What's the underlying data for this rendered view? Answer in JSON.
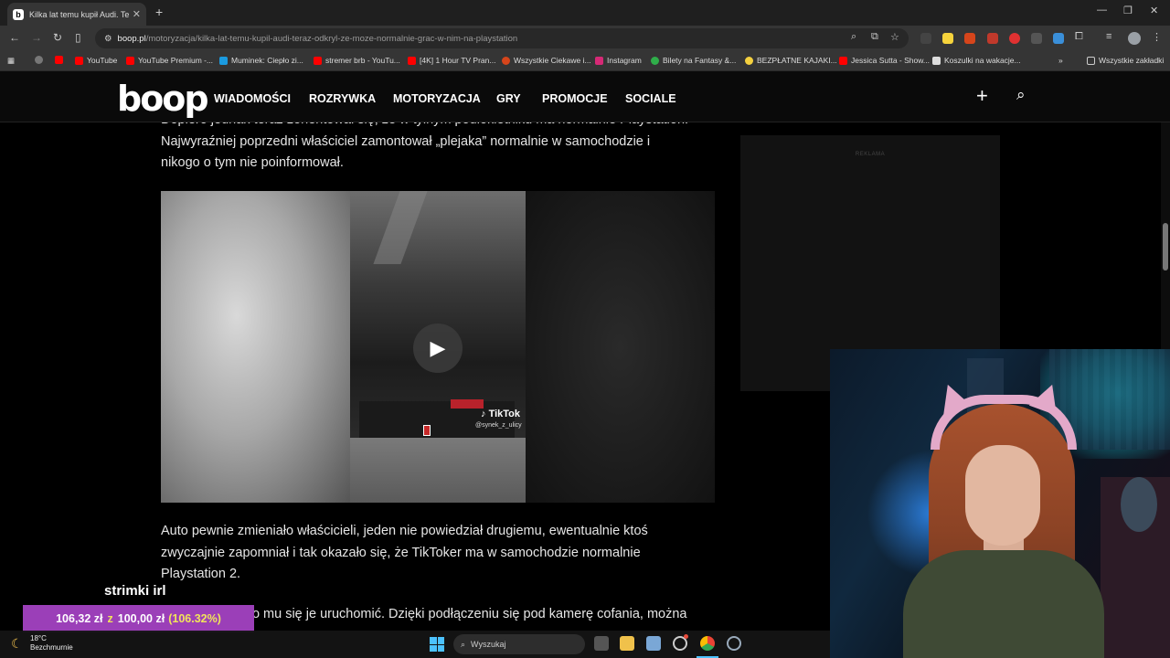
{
  "browser": {
    "tab_title": "Kilka lat temu kupił Audi. Teraz",
    "tab_favicon": "b",
    "url_host": "boop.pl",
    "url_path": "/motoryzacja/kilka-lat-temu-kupil-audi-teraz-odkryl-ze-moze-normalnie-grac-w-nim-na-playstation",
    "bookmarks": [
      {
        "label": "YouTube",
        "color": "#ff0000"
      },
      {
        "label": "YouTube Premium -...",
        "color": "#ff0000"
      },
      {
        "label": "Muminek: Ciepło zi...",
        "color": "#1b9be0"
      },
      {
        "label": "stremer brb - YouTu...",
        "color": "#ff0000"
      },
      {
        "label": "[4K] 1 Hour TV Pran...",
        "color": "#ff0000"
      },
      {
        "label": "Wszystkie Ciekawe i...",
        "color": "#d6451b"
      },
      {
        "label": "Instagram",
        "color": "#d62976"
      },
      {
        "label": "Bilety na Fantasy &...",
        "color": "#2fae4a"
      },
      {
        "label": "BEZPŁATNE KAJAKI...",
        "color": "#f4d03f"
      },
      {
        "label": "Jessica Sutta - Show...",
        "color": "#ff0000"
      },
      {
        "label": "Koszulki na wakacje...",
        "color": "#222222"
      }
    ],
    "all_bookmarks": "Wszystkie zakładki"
  },
  "site": {
    "logo": "boop",
    "nav": [
      "WIADOMOŚCI",
      "ROZRYWKA",
      "MOTORYZACJA",
      "GRY",
      "PROMOCJE",
      "SOCIALE"
    ]
  },
  "article": {
    "para1_line1": "Dopiero jednak teraz zorientował się, że w tylnym podłokietniku ma normalnie Playstation.",
    "para1_line2": "Najwyraźniej poprzedni właściciel zamontował „plejaka” normalnie w samochodzie i",
    "para1_line3": "nikogo o tym nie poinformował.",
    "para2_line1": "Auto pewnie zmieniało właścicieli, jeden nie powiedział drugiemu, ewentualnie ktoś",
    "para2_line2": "zwyczajnie zapomniał i tak okazało się, że TikToker ma w samochodzie normalnie",
    "para2_line3": "Playstation 2.",
    "para3_line1": "Co lepsze, udało mu się je uruchomić. Dzięki podłączeniu się pod kamerę cofania, można",
    "ad_label": "REKLAMA",
    "video": {
      "tiktok_label": "TikTok",
      "tiktok_user": "@synek_z_ulicy"
    }
  },
  "overlay": {
    "title": "strimki irl",
    "goal_current": "106,32 zł",
    "goal_sep": "z",
    "goal_target": "100,00 zł",
    "goal_percent": "(106.32%)"
  },
  "taskbar": {
    "temp": "18°C",
    "weather": "Bezchmurnie",
    "search_label": "Wyszukaj"
  }
}
